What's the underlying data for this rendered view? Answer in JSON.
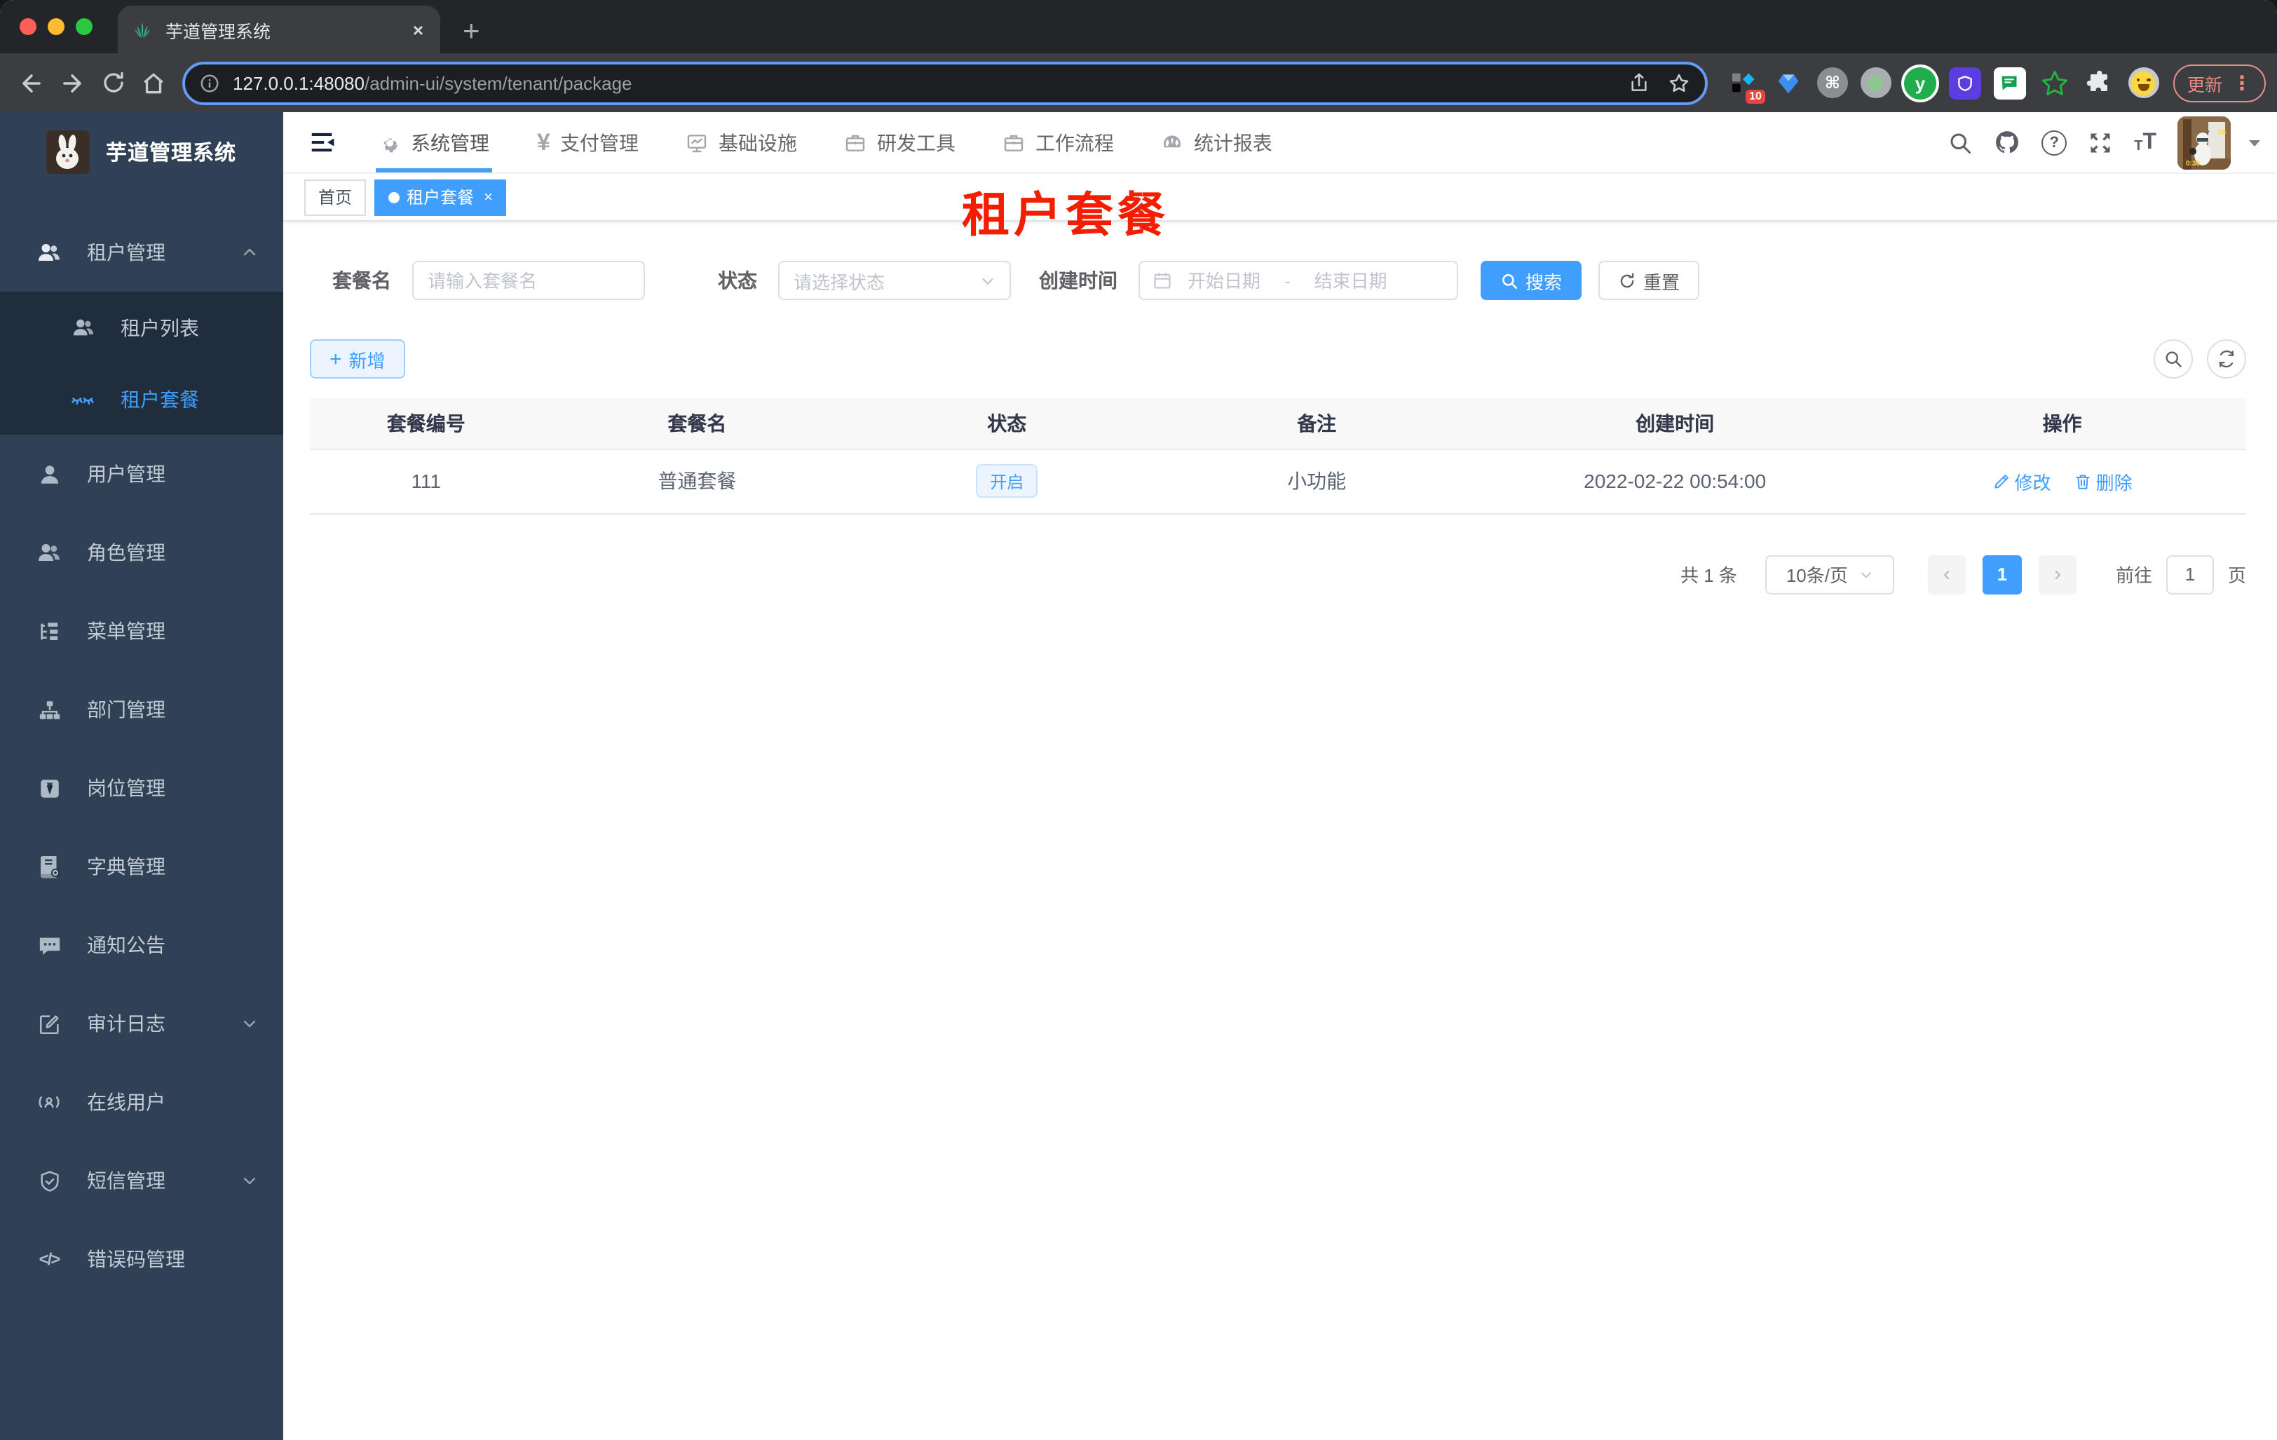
{
  "browser": {
    "tab_title": "芋道管理系统",
    "url_host": "127.0.0.1:48080",
    "url_path": "/admin-ui/system/tenant/package",
    "update_label": "更新",
    "extension_badge": "10"
  },
  "icons": {
    "close_tab": "×",
    "new_tab": "+",
    "cmd": "⌘",
    "ext_y": "y",
    "yen": "¥",
    "help": "?",
    "kebab": "⋮",
    "code": "</>",
    "font_big": "T",
    "font_small": "T",
    "prev": "‹",
    "next": "›",
    "plus": "+",
    "tag_close": "×"
  },
  "colors": {
    "accent": "#409eff",
    "sidebar_bg": "#304156",
    "submenu_bg": "#1f2d3d",
    "annotation_red": "#f51d00",
    "tag_active": "#409eff"
  },
  "sidebar": {
    "logo_title": "芋道管理系统",
    "items": [
      {
        "label": "租户管理"
      },
      {
        "label": "租户列表"
      },
      {
        "label": "租户套餐"
      },
      {
        "label": "用户管理"
      },
      {
        "label": "角色管理"
      },
      {
        "label": "菜单管理"
      },
      {
        "label": "部门管理"
      },
      {
        "label": "岗位管理"
      },
      {
        "label": "字典管理"
      },
      {
        "label": "通知公告"
      },
      {
        "label": "审计日志"
      },
      {
        "label": "在线用户"
      },
      {
        "label": "短信管理"
      },
      {
        "label": "错误码管理"
      }
    ]
  },
  "topnav": {
    "items": [
      {
        "label": "系统管理"
      },
      {
        "label": "支付管理"
      },
      {
        "label": "基础设施"
      },
      {
        "label": "研发工具"
      },
      {
        "label": "工作流程"
      },
      {
        "label": "统计报表"
      }
    ]
  },
  "tags": {
    "home": "首页",
    "active_tab": "租户套餐"
  },
  "annotation": "租户套餐",
  "filters": {
    "name_label": "套餐名",
    "name_placeholder": "请输入套餐名",
    "status_label": "状态",
    "status_placeholder": "请选择状态",
    "date_label": "创建时间",
    "date_start_placeholder": "开始日期",
    "date_separator": "-",
    "date_end_placeholder": "结束日期",
    "search_label": "搜索",
    "reset_label": "重置",
    "add_label": "新增"
  },
  "table": {
    "columns": [
      "套餐编号",
      "套餐名",
      "状态",
      "备注",
      "创建时间",
      "操作"
    ],
    "rows": [
      {
        "id": "111",
        "name": "普通套餐",
        "status": "开启",
        "remark": "小功能",
        "created_at": "2022-02-22 00:54:00",
        "edit_label": "修改",
        "delete_label": "删除"
      }
    ]
  },
  "pagination": {
    "total": "共 1 条",
    "page_size": "10条/页",
    "current_page": "1",
    "goto_label": "前往",
    "goto_value": "1",
    "page_unit": "页"
  }
}
